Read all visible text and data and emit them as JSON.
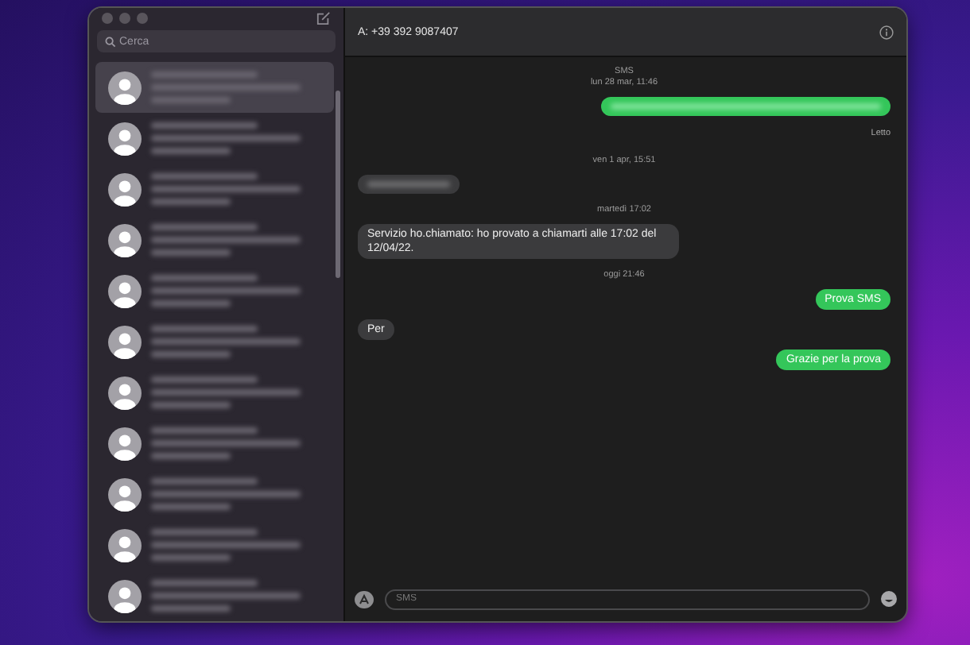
{
  "search": {
    "placeholder": "Cerca"
  },
  "conversations": [
    {
      "selected": true
    },
    {
      "selected": false
    },
    {
      "selected": false
    },
    {
      "selected": false
    },
    {
      "selected": false
    },
    {
      "selected": false
    },
    {
      "selected": false
    },
    {
      "selected": false
    },
    {
      "selected": false
    },
    {
      "selected": false
    },
    {
      "selected": false
    }
  ],
  "header": {
    "recipient": "A: +39 392 9087407"
  },
  "messages": [
    {
      "kind": "timestamp",
      "lines": [
        "SMS",
        "lun 28 mar, 11:46"
      ]
    },
    {
      "kind": "redacted",
      "outgoing": true
    },
    {
      "kind": "receipt",
      "text": "Letto"
    },
    {
      "kind": "timestamp",
      "lines": [
        "ven 1 apr, 15:51"
      ]
    },
    {
      "kind": "redacted",
      "outgoing": false
    },
    {
      "kind": "timestamp",
      "lines": [
        "martedì 17:02"
      ]
    },
    {
      "kind": "text",
      "outgoing": false,
      "text": "Servizio ho.chiamato: ho provato a chiamarti alle 17:02 del 12/04/22."
    },
    {
      "kind": "timestamp",
      "lines": [
        "oggi 21:46"
      ]
    },
    {
      "kind": "text",
      "outgoing": true,
      "text": "Prova SMS"
    },
    {
      "kind": "text",
      "outgoing": false,
      "text": "Per"
    },
    {
      "kind": "text",
      "outgoing": true,
      "text": "Grazie per la prova"
    }
  ],
  "composer": {
    "placeholder": "SMS"
  }
}
